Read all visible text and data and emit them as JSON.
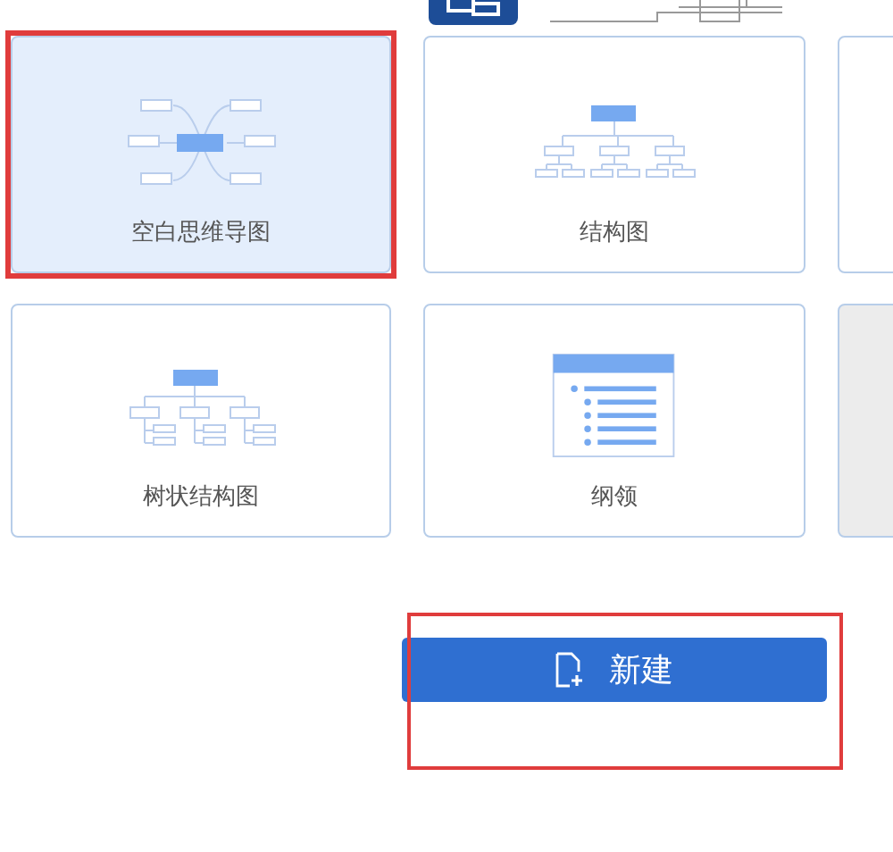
{
  "cards": [
    {
      "kind": "mindmap",
      "label": "空白思维导图",
      "selected": true,
      "highlighted": true
    },
    {
      "kind": "structure",
      "label": "结构图",
      "selected": false,
      "highlighted": false
    },
    {
      "kind": "blank",
      "shaded": false,
      "selected": false,
      "highlighted": false
    },
    {
      "kind": "tree",
      "label": "树状结构图",
      "selected": false,
      "highlighted": false
    },
    {
      "kind": "outline",
      "label": "纲领",
      "selected": false,
      "highlighted": false
    },
    {
      "kind": "blank",
      "shaded": true,
      "selected": false,
      "highlighted": false
    }
  ],
  "new_button": {
    "label": "新建",
    "highlighted": true
  }
}
